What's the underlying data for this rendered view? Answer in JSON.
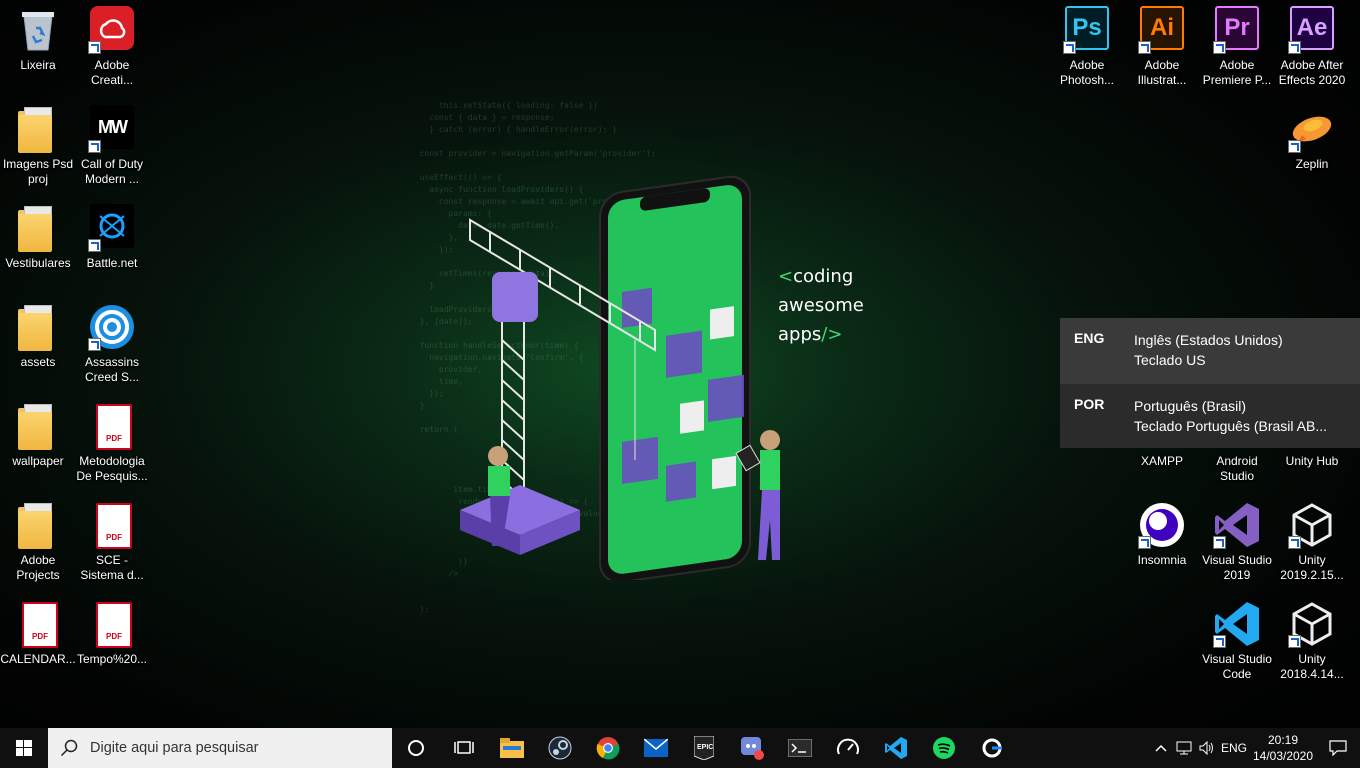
{
  "desktop_icons_left": [
    {
      "label": "Lixeira",
      "icon": "recycle-bin-icon"
    },
    {
      "label": "Adobe Creati...",
      "icon": "adobe-cc-icon"
    },
    {
      "label": "Imagens Psd proj",
      "icon": "folder-icon"
    },
    {
      "label": "Call of Duty Modern ...",
      "icon": "cod-mw-icon"
    },
    {
      "label": "Vestibulares",
      "icon": "folder-icon"
    },
    {
      "label": "Battle.net",
      "icon": "battlenet-icon"
    },
    {
      "label": "assets",
      "icon": "folder-icon"
    },
    {
      "label": "Assassins Creed S...",
      "icon": "uplay-icon"
    },
    {
      "label": "wallpaper",
      "icon": "folder-icon"
    },
    {
      "label": "Metodologia De Pesquis...",
      "icon": "pdf-icon"
    },
    {
      "label": "Adobe Projects",
      "icon": "folder-icon"
    },
    {
      "label": "SCE - Sistema d...",
      "icon": "pdf-icon"
    },
    {
      "label": "CALENDAR...",
      "icon": "pdf-icon"
    },
    {
      "label": "Tempo%20...",
      "icon": "pdf-icon"
    }
  ],
  "desktop_icons_right": [
    {
      "label": "Adobe Photosh...",
      "icon": "photoshop-icon",
      "abbr": "Ps"
    },
    {
      "label": "Adobe Illustrat...",
      "icon": "illustrator-icon",
      "abbr": "Ai"
    },
    {
      "label": "Adobe Premiere P...",
      "icon": "premiere-icon",
      "abbr": "Pr"
    },
    {
      "label": "Adobe After Effects 2020",
      "icon": "after-effects-icon",
      "abbr": "Ae"
    },
    {
      "label": "Zeplin",
      "icon": "zeplin-icon"
    },
    {
      "label": "XAMPP",
      "icon": "xampp-icon"
    },
    {
      "label": "Android Studio",
      "icon": "android-studio-icon"
    },
    {
      "label": "Unity Hub",
      "icon": "unity-hub-icon"
    },
    {
      "label": "Insomnia",
      "icon": "insomnia-icon"
    },
    {
      "label": "Visual Studio 2019",
      "icon": "visual-studio-icon"
    },
    {
      "label": "Unity 2019.2.15...",
      "icon": "unity-icon"
    },
    {
      "label": "Visual Studio Code",
      "icon": "vscode-icon"
    },
    {
      "label": "Unity 2018.4.14...",
      "icon": "unity-icon"
    }
  ],
  "wallpaper": {
    "line1_bracket": "<",
    "line1": "coding",
    "line2": "awesome",
    "line3": "apps",
    "line3_tag": "/>"
  },
  "language_popup": [
    {
      "code": "ENG",
      "language": "Inglês (Estados Unidos)",
      "keyboard": "Teclado US"
    },
    {
      "code": "POR",
      "language": "Português (Brasil)",
      "keyboard": "Teclado Português (Brasil AB..."
    }
  ],
  "taskbar": {
    "search_placeholder": "Digite aqui para pesquisar",
    "apps": [
      "cortana-icon",
      "task-view-icon",
      "file-explorer-icon",
      "steam-icon",
      "chrome-icon",
      "mail-icon",
      "epic-games-icon",
      "discord-icon",
      "terminal-icon",
      "speedtest-icon",
      "vscode-icon",
      "spotify-icon",
      "app-icon"
    ],
    "tray": {
      "lang": "ENG",
      "time": "20:19",
      "date": "14/03/2020"
    }
  },
  "colors": {
    "accent_green": "#3ddc73",
    "taskbar": "#101010",
    "popup": "#2b2b2b"
  }
}
